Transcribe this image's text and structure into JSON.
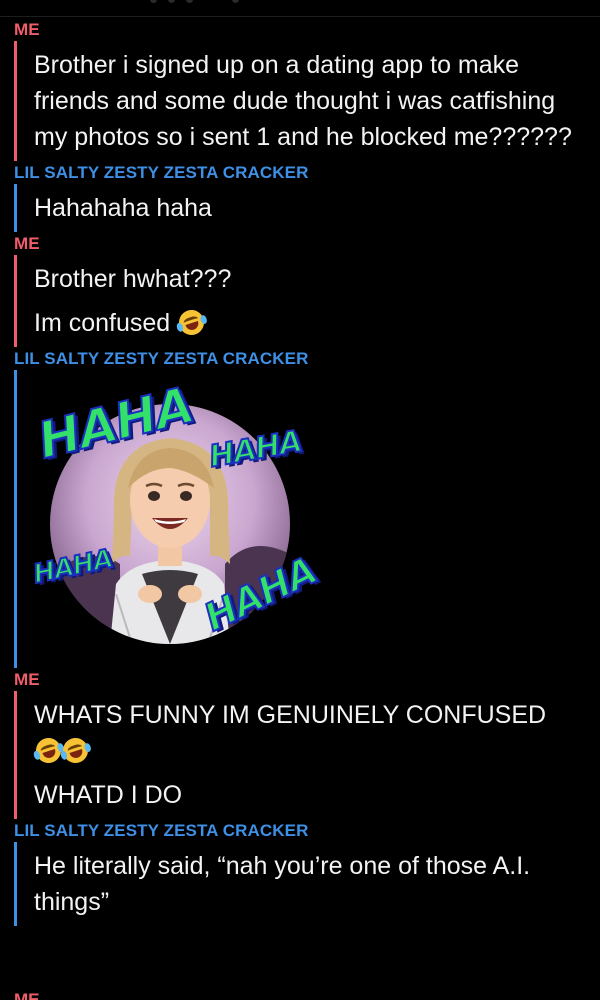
{
  "conversation": [
    {
      "sender": "ME",
      "side": "me",
      "messages": [
        "Brother i signed up on a dating app to make friends and some dude thought i was catfishing my photos so i sent 1 and he blocked me??????"
      ]
    },
    {
      "sender": "LIL SALTY ZESTY ZESTA CRACKER",
      "side": "friend",
      "messages": [
        "Hahahaha haha"
      ]
    },
    {
      "sender": "ME",
      "side": "me",
      "messages": [
        "Brother hwhat???",
        "Im confused"
      ]
    },
    {
      "sender": "LIL SALTY ZESTY ZESTA CRACKER",
      "side": "friend",
      "sticker": {
        "type": "bitmoji-laughing",
        "texts": [
          "HAHA",
          "HAHA",
          "HAHA",
          "HAHA"
        ]
      }
    },
    {
      "sender": "ME",
      "side": "me",
      "messages": [
        "WHATS FUNNY IM GENUINELY CONFUSED",
        "WHATD I DO"
      ]
    },
    {
      "sender": "LIL SALTY ZESTY ZESTA CRACKER",
      "side": "friend",
      "messages": [
        "He literally said, “nah you’re one of those A.I. things”"
      ]
    }
  ],
  "cut_off_sender": "ME",
  "emoji": {
    "name": "rolling-on-floor-laughing-icon"
  },
  "colors": {
    "background": "#000000",
    "me_accent": "#f05d6b",
    "friend_accent": "#3e8fe6",
    "text": "#f3f3f3"
  }
}
